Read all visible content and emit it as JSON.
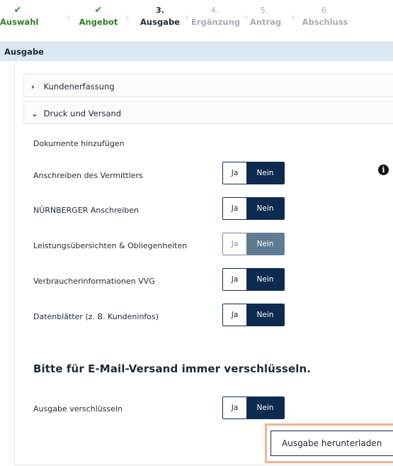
{
  "stepper": {
    "steps": [
      {
        "mark": "✔",
        "label": "Auswahl",
        "state": "done"
      },
      {
        "mark": "✔",
        "label": "Angebot",
        "state": "done"
      },
      {
        "mark": "3.",
        "label": "Ausgabe",
        "state": "active"
      },
      {
        "mark": "4.",
        "label": "Ergänzung",
        "state": "future"
      },
      {
        "mark": "5.",
        "label": "Antrag",
        "state": "future"
      },
      {
        "mark": "6.",
        "label": "Abschluss",
        "state": "future"
      }
    ],
    "separator": "›"
  },
  "section": {
    "title": "Ausgabe"
  },
  "accordions": {
    "kunden": {
      "arrow": "›",
      "label": "Kundenerfassung",
      "expanded": false
    },
    "druck": {
      "arrow": "⌄",
      "label": "Druck und Versand",
      "expanded": true
    }
  },
  "documents": {
    "subtitle": "Dokumente hinzufügen",
    "rows": [
      {
        "label": "Anschreiben des Vermittlers",
        "yes": "Ja",
        "no": "Nein",
        "selected": "Nein",
        "disabled": false
      },
      {
        "label": "NÜRNBERGER Anschreiben",
        "yes": "Ja",
        "no": "Nein",
        "selected": "Nein",
        "disabled": false
      },
      {
        "label": "Leistungsübersichten & Obliegenheiten",
        "yes": "Ja",
        "no": "Nein",
        "selected": "Nein",
        "disabled": true
      },
      {
        "label": "Verbraucherinformationen VVG",
        "yes": "Ja",
        "no": "Nein",
        "selected": "Nein",
        "disabled": false
      },
      {
        "label": "Datenblätter (z. B. Kundeninfos)",
        "yes": "Ja",
        "no": "Nein",
        "selected": "Nein",
        "disabled": false
      }
    ],
    "info_icon": "i"
  },
  "encryption": {
    "heading": "Bitte für E-Mail-Versand immer verschlüsseln.",
    "row": {
      "label": "Ausgabe verschlüsseln",
      "yes": "Ja",
      "no": "Nein",
      "selected": "Nein"
    }
  },
  "actions": {
    "download_label": "Ausgabe herunterladen"
  },
  "colors": {
    "navy": "#0d2b4e",
    "done_green": "#2f7d21",
    "section_bg": "#dde7ef",
    "highlight": "#f2b38f"
  }
}
